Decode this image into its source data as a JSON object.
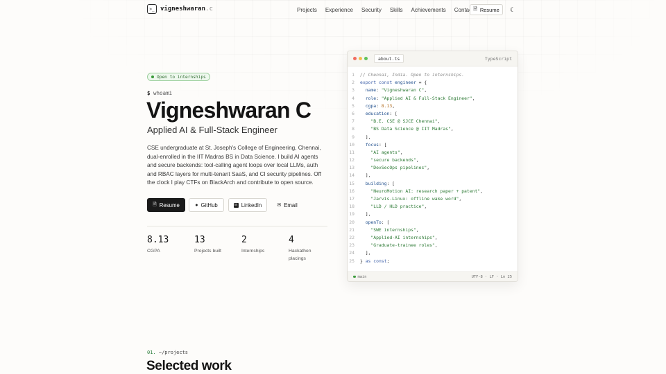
{
  "nav": {
    "logo_glyph": ">_",
    "brand_main": "vigneshwaran",
    "brand_suffix": ".c",
    "links": [
      "Projects",
      "Experience",
      "Security",
      "Skills",
      "Achievements",
      "Contact"
    ],
    "resume_label": "Resume",
    "theme_icon": "moon-icon"
  },
  "hero": {
    "badge": "Open to internships",
    "prompt_symbol": "$",
    "prompt_cmd": "whoami",
    "name": "Vigneshwaran C",
    "role": "Applied AI & Full-Stack Engineer",
    "bio": "CSE undergraduate at St. Joseph's College of Engineering, Chennai, dual-enrolled in the IIT Madras BS in Data Science. I build AI agents and secure backends: tool-calling agent loops over local LLMs, auth and RBAC layers for multi-tenant SaaS, and CI security pipelines. Off the clock I play CTFs on BlackArch and contribute to open source.",
    "buttons": {
      "resume": "Resume",
      "github": "GitHub",
      "linkedin": "LinkedIn",
      "email": "Email"
    },
    "stats": [
      {
        "value": "8.13",
        "label": "CGPA"
      },
      {
        "value": "13",
        "label": "Projects built"
      },
      {
        "value": "2",
        "label": "Internships"
      },
      {
        "value": "4",
        "label": "Hackathon placings"
      }
    ]
  },
  "code": {
    "filename": "about.ts",
    "language": "TypeScript",
    "branch": "main",
    "status": "UTF-8 · LF · Ln 25",
    "colors": {
      "red": "#f26b5e",
      "yellow": "#f4bd4f",
      "green": "#5fc35a"
    },
    "lines": [
      [
        {
          "t": "// Chennai, India. Open to internships.",
          "c": "com"
        }
      ],
      [
        {
          "t": "export const ",
          "c": "kw"
        },
        {
          "t": "engineer",
          "c": "prop"
        },
        {
          "t": " = {",
          "c": ""
        }
      ],
      [
        {
          "t": "  ",
          "c": ""
        },
        {
          "t": "name",
          "c": "prop"
        },
        {
          "t": ": ",
          "c": ""
        },
        {
          "t": "\"Vigneshwaran C\"",
          "c": "str"
        },
        {
          "t": ",",
          "c": ""
        }
      ],
      [
        {
          "t": "  ",
          "c": ""
        },
        {
          "t": "role",
          "c": "prop"
        },
        {
          "t": ": ",
          "c": ""
        },
        {
          "t": "\"Applied AI & Full-Stack Engineer\"",
          "c": "str"
        },
        {
          "t": ",",
          "c": ""
        }
      ],
      [
        {
          "t": "  ",
          "c": ""
        },
        {
          "t": "cgpa",
          "c": "prop"
        },
        {
          "t": ": ",
          "c": ""
        },
        {
          "t": "8.13",
          "c": "num"
        },
        {
          "t": ",",
          "c": ""
        }
      ],
      [
        {
          "t": "  ",
          "c": ""
        },
        {
          "t": "education",
          "c": "prop"
        },
        {
          "t": ": [",
          "c": ""
        }
      ],
      [
        {
          "t": "    ",
          "c": ""
        },
        {
          "t": "\"B.E. CSE @ SJCE Chennai\"",
          "c": "str"
        },
        {
          "t": ",",
          "c": ""
        }
      ],
      [
        {
          "t": "    ",
          "c": ""
        },
        {
          "t": "\"BS Data Science @ IIT Madras\"",
          "c": "str"
        },
        {
          "t": ",",
          "c": ""
        }
      ],
      [
        {
          "t": "  ],",
          "c": ""
        }
      ],
      [
        {
          "t": "  ",
          "c": ""
        },
        {
          "t": "focus",
          "c": "prop"
        },
        {
          "t": ": [",
          "c": ""
        }
      ],
      [
        {
          "t": "    ",
          "c": ""
        },
        {
          "t": "\"AI agents\"",
          "c": "str"
        },
        {
          "t": ",",
          "c": ""
        }
      ],
      [
        {
          "t": "    ",
          "c": ""
        },
        {
          "t": "\"secure backends\"",
          "c": "str"
        },
        {
          "t": ",",
          "c": ""
        }
      ],
      [
        {
          "t": "    ",
          "c": ""
        },
        {
          "t": "\"DevSecOps pipelines\"",
          "c": "str"
        },
        {
          "t": ",",
          "c": ""
        }
      ],
      [
        {
          "t": "  ],",
          "c": ""
        }
      ],
      [
        {
          "t": "  ",
          "c": ""
        },
        {
          "t": "building",
          "c": "prop"
        },
        {
          "t": ": [",
          "c": ""
        }
      ],
      [
        {
          "t": "    ",
          "c": ""
        },
        {
          "t": "\"NeuroMotion AI: research paper + patent\"",
          "c": "str"
        },
        {
          "t": ",",
          "c": ""
        }
      ],
      [
        {
          "t": "    ",
          "c": ""
        },
        {
          "t": "\"Jarvis-Linux: offline wake word\"",
          "c": "str"
        },
        {
          "t": ",",
          "c": ""
        }
      ],
      [
        {
          "t": "    ",
          "c": ""
        },
        {
          "t": "\"LLD / HLD practice\"",
          "c": "str"
        },
        {
          "t": ",",
          "c": ""
        }
      ],
      [
        {
          "t": "  ],",
          "c": ""
        }
      ],
      [
        {
          "t": "  ",
          "c": ""
        },
        {
          "t": "openTo",
          "c": "prop"
        },
        {
          "t": ": [",
          "c": ""
        }
      ],
      [
        {
          "t": "    ",
          "c": ""
        },
        {
          "t": "\"SWE internships\"",
          "c": "str"
        },
        {
          "t": ",",
          "c": ""
        }
      ],
      [
        {
          "t": "    ",
          "c": ""
        },
        {
          "t": "\"Applied-AI internships\"",
          "c": "str"
        },
        {
          "t": ",",
          "c": ""
        }
      ],
      [
        {
          "t": "    ",
          "c": ""
        },
        {
          "t": "\"Graduate-trainee roles\"",
          "c": "str"
        },
        {
          "t": ",",
          "c": ""
        }
      ],
      [
        {
          "t": "  ],",
          "c": ""
        }
      ],
      [
        {
          "t": "} ",
          "c": ""
        },
        {
          "t": "as const",
          "c": "kw"
        },
        {
          "t": ";",
          "c": ""
        }
      ]
    ]
  },
  "section": {
    "number": "01.",
    "path": "~/projects",
    "title": "Selected work"
  }
}
